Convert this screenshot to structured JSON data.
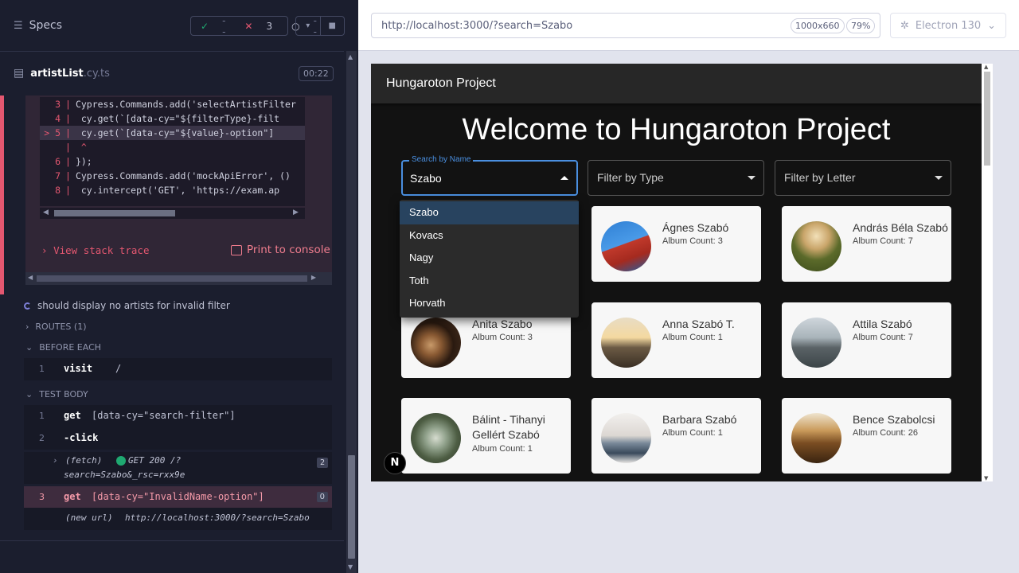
{
  "specs": {
    "title": "Specs",
    "passed": "--",
    "failed": "3",
    "pending": "--"
  },
  "file": {
    "name": "artistList",
    "ext": ".cy.ts",
    "timer": "00:22"
  },
  "code": {
    "lines": [
      {
        "num": "3",
        "text": "Cypress.Commands.add('selectArtistFilter"
      },
      {
        "num": "4",
        "text": "    cy.get(`[data-cy=\"${filterType}-filt"
      },
      {
        "num": "5",
        "text": "    cy.get(`[data-cy=\"${value}-option\"]"
      },
      {
        "num": "",
        "text": "    ^"
      },
      {
        "num": "6",
        "text": "});"
      },
      {
        "num": "7",
        "text": "Cypress.Commands.add('mockApiError', ()"
      },
      {
        "num": "8",
        "text": "    cy.intercept('GET', 'https://exam.ap"
      }
    ],
    "view_stack": "View stack trace",
    "print_console": "Print to console"
  },
  "test": {
    "title": "should display no artists for invalid filter",
    "routes": "ROUTES (1)",
    "before_each": "BEFORE EACH",
    "visit": {
      "num": "1",
      "name": "visit",
      "arg": "/"
    },
    "test_body": "TEST BODY",
    "commands": [
      {
        "num": "1",
        "name": "get",
        "arg": "[data-cy=\"search-filter\"]"
      },
      {
        "num": "2",
        "name": "-click",
        "arg": ""
      },
      {
        "num": "3",
        "name": "get",
        "arg": "[data-cy=\"InvalidName-option\"]",
        "badge": "0"
      }
    ],
    "fetch": {
      "label": "(fetch)",
      "request": "GET 200 /?",
      "url": "search=Szabo&_rsc=rxx9e",
      "badge": "2"
    },
    "new_url": {
      "label": "(new url)",
      "url": "http://localhost:3000/?search=Szabo"
    }
  },
  "browser": {
    "url": "http://localhost:3000/?search=Szabo",
    "viewport": "1000x660",
    "zoom": "79%",
    "engine": "Electron 130"
  },
  "app": {
    "bar_title": "Hungaroton Project",
    "heading": "Welcome to Hungaroton Project",
    "search_label": "Search by Name",
    "search_value": "Szabo",
    "filter_type": "Filter by Type",
    "filter_letter": "Filter by Letter",
    "dropdown": [
      "Szabo",
      "Kovacs",
      "Nagy",
      "Toth",
      "Horvath"
    ],
    "artists": [
      {
        "name": "Ágnes Szabó",
        "count": "Album Count: 3"
      },
      {
        "name": "András Béla Szabó",
        "count": "Album Count: 7"
      },
      {
        "name": "Anita Szabo",
        "count": "Album Count: 3"
      },
      {
        "name": "Anna Szabó T.",
        "count": "Album Count: 1"
      },
      {
        "name": "Attila Szabó",
        "count": "Album Count: 7"
      },
      {
        "name": "Bálint - Tihanyi Gellért Szabó",
        "count": "Album Count: 1"
      },
      {
        "name": "Barbara Szabó",
        "count": "Album Count: 1"
      },
      {
        "name": "Bence Szabolcsi",
        "count": "Album Count: 26"
      }
    ],
    "next_badge": "N"
  },
  "colors": {
    "error": "#e45770",
    "accent": "#4a8fe0",
    "panel": "#1b1e2e"
  }
}
